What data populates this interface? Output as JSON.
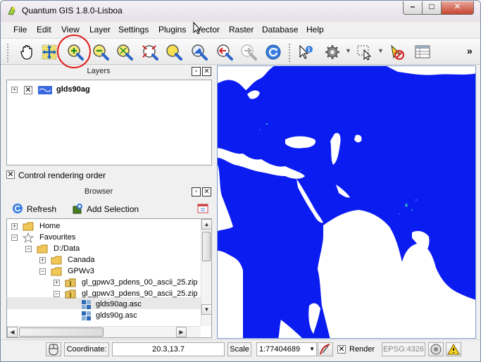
{
  "window": {
    "title": "Quantum GIS 1.8.0-Lisboa"
  },
  "menu": [
    "File",
    "Edit",
    "View",
    "Layer",
    "Settings",
    "Plugins",
    "Vector",
    "Raster",
    "Database",
    "Help"
  ],
  "toolbar": {
    "overflow": "»",
    "buttons": [
      "pan-icon",
      "pan-to-selection-icon",
      "zoom-in-icon",
      "zoom-out-icon",
      "zoom-full-icon",
      "zoom-to-selection-icon",
      "zoom-to-layer-icon",
      "zoom-native-icon",
      "zoom-last-icon",
      "zoom-next-icon",
      "refresh-icon",
      "identify-icon",
      "action-icon",
      "select-icon",
      "deselect-icon",
      "attribute-table-icon"
    ]
  },
  "layers_panel": {
    "title": "Layers",
    "layer_name": "glds90ag",
    "control_rendering_order": "Control rendering order"
  },
  "browser_panel": {
    "title": "Browser",
    "refresh": "Refresh",
    "add_selection": "Add Selection",
    "tree": [
      {
        "label": "Home"
      },
      {
        "label": "Favourites"
      },
      {
        "label": "D:/Data"
      },
      {
        "label": "Canada"
      },
      {
        "label": "GPWv3"
      },
      {
        "label": "gl_gpwv3_pdens_00_ascii_25.zip"
      },
      {
        "label": "gl_gpwv3_pdens_90_ascii_25.zip"
      },
      {
        "label": "glds90ag.asc"
      },
      {
        "label": "glds90g.asc"
      }
    ]
  },
  "statusbar": {
    "coordinate_label": "Coordinate:",
    "coordinate_value": "20.3,13.7",
    "scale_label": "Scale",
    "scale_value": "1:77404689",
    "render_label": "Render",
    "epsg": "EPSG:4326"
  },
  "colors": {
    "map_land": "#0b1cf0",
    "map_water": "#ffffff",
    "highlight": "#e02020"
  }
}
